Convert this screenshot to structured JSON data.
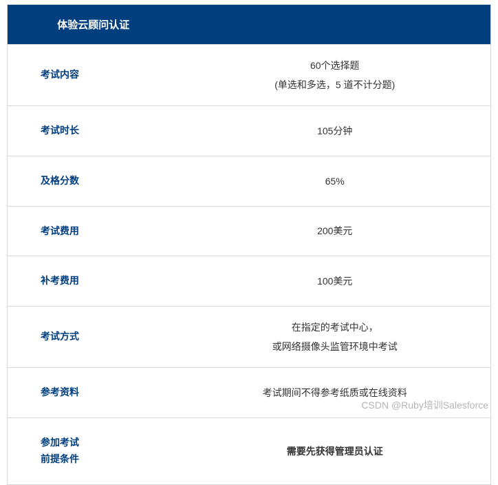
{
  "header": {
    "title": "体验云顾问认证"
  },
  "rows": [
    {
      "label": "考试内容",
      "value_line1": "60个选择题",
      "value_line2": "(单选和多选，5 道不计分题)"
    },
    {
      "label": "考试时长",
      "value_line1": "105分钟"
    },
    {
      "label": "及格分数",
      "value_line1": "65%"
    },
    {
      "label": "考试费用",
      "value_line1": "200美元"
    },
    {
      "label": "补考费用",
      "value_line1": "100美元"
    },
    {
      "label": "考试方式",
      "value_line1": "在指定的考试中心，",
      "value_line2": "或网络摄像头监管环境中考试"
    },
    {
      "label": "参考资料",
      "value_line1": "考试期间不得参考纸质或在线资料"
    },
    {
      "label_line1": "参加考试",
      "label_line2": "前提条件",
      "value_line1": "需要先获得管理员认证",
      "bold": true
    }
  ],
  "watermark": "CSDN @Ruby培训Salesforce"
}
